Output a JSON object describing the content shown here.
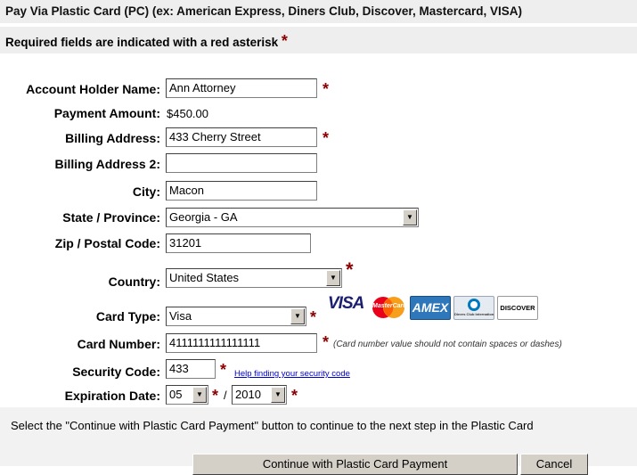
{
  "header": {
    "title": "Pay Via Plastic Card (PC) (ex: American Express, Diners Club, Discover, Mastercard, VISA)",
    "required_note": "Required fields are indicated with a red asterisk",
    "asterisk": "*"
  },
  "form": {
    "account_holder": {
      "label": "Account Holder Name:",
      "value": "Ann Attorney"
    },
    "payment_amount": {
      "label": "Payment Amount:",
      "value": "$450.00"
    },
    "billing_address": {
      "label": "Billing Address:",
      "value": "433 Cherry Street"
    },
    "billing_address2": {
      "label": "Billing Address 2:",
      "value": ""
    },
    "city": {
      "label": "City:",
      "value": "Macon"
    },
    "state": {
      "label": "State / Province:",
      "value": "Georgia - GA"
    },
    "zip": {
      "label": "Zip / Postal Code:",
      "value": "31201"
    },
    "country": {
      "label": "Country:",
      "value": "United States"
    },
    "card_type": {
      "label": "Card Type:",
      "value": "Visa"
    },
    "card_number": {
      "label": "Card Number:",
      "value": "4111111111111111",
      "note": "(Card number value should not contain spaces or dashes)"
    },
    "security_code": {
      "label": "Security Code:",
      "value": "433",
      "help_link": "Help finding your security code"
    },
    "expiration": {
      "label": "Expiration Date:",
      "month": "05",
      "separator": "/",
      "year": "2010"
    }
  },
  "card_logos": {
    "visa": "VISA",
    "mastercard": "MasterCard",
    "amex": "AMEX",
    "diners": "Diners Club International",
    "discover": "DISCOVER"
  },
  "footer": {
    "instruction": "Select the \"Continue with Plastic Card Payment\" button to continue to the next step in the Plastic Card",
    "continue_label": "Continue with Plastic Card Payment",
    "cancel_label": "Cancel"
  },
  "colors": {
    "asterisk": "#8b0000",
    "header_bg": "#eeeeee",
    "link": "#0000cc",
    "visa_blue": "#1a1f71",
    "mastercard_red": "#eb001b",
    "mastercard_orange": "#f79e1b",
    "amex_blue": "#2e77bb",
    "discover_orange": "#f58220"
  }
}
